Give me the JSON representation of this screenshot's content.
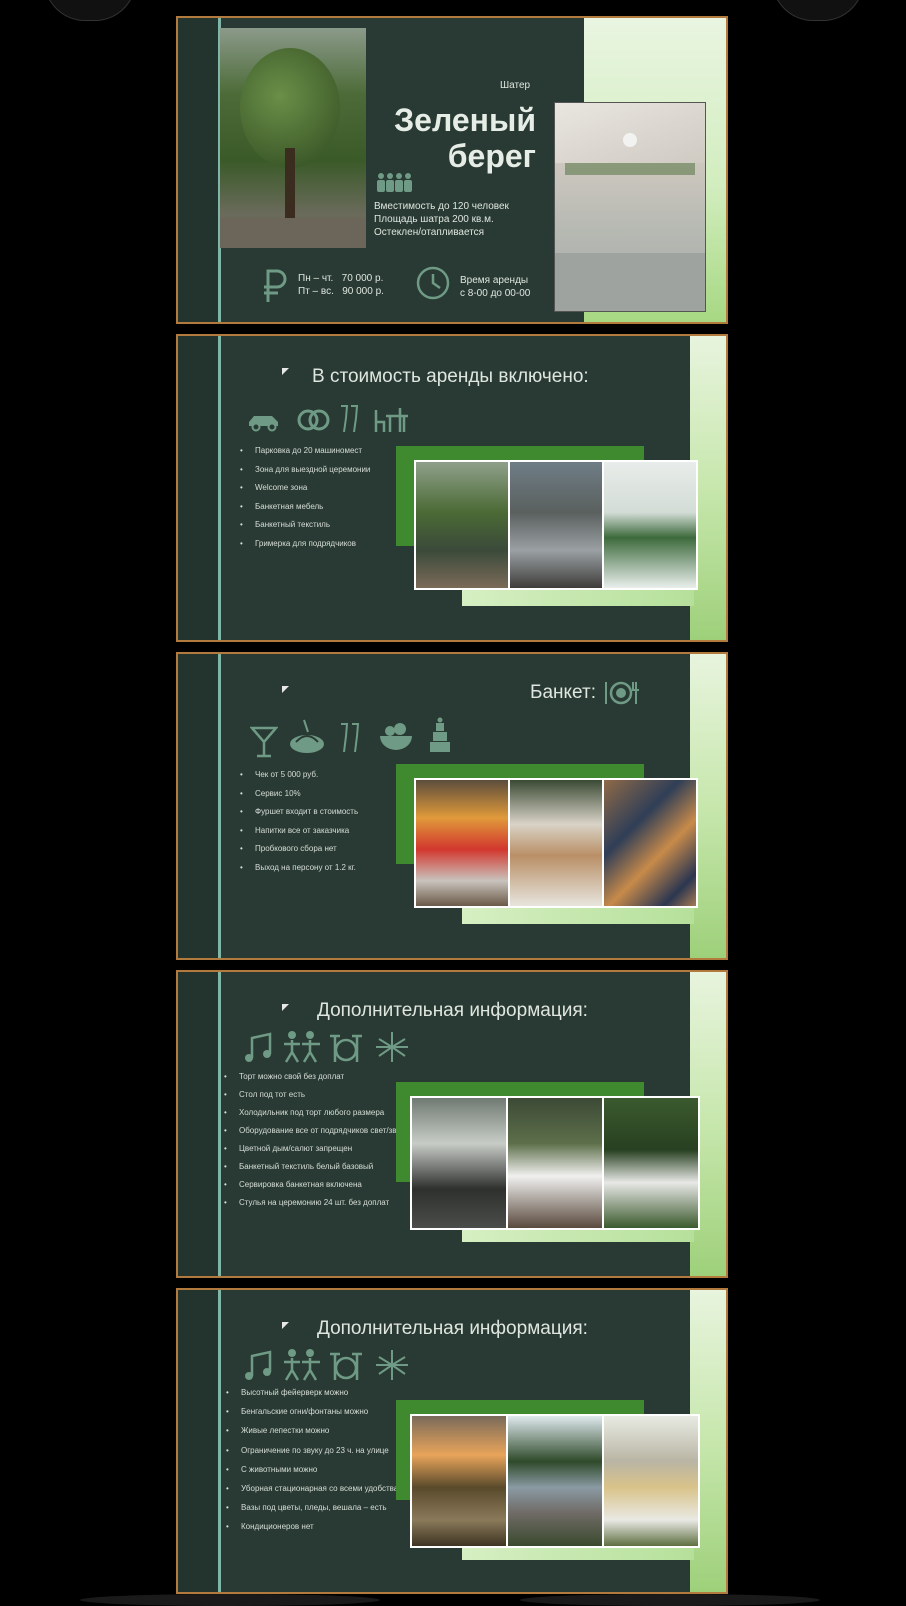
{
  "slide1": {
    "tag": "Шатер",
    "title_line1": "Зеленый",
    "title_line2": "берег",
    "features": [
      "Вместимость до 120 человек",
      "Площадь шатра 200 кв.м.",
      "Остеклен/отапливается"
    ],
    "price_rows": [
      {
        "days": "Пн – чт.",
        "price": "70 000 р."
      },
      {
        "days": "Пт – вс.",
        "price": "90 000 р."
      }
    ],
    "rent_time_line1": "Время аренды",
    "rent_time_line2": "с 8-00 до 00-00",
    "icons": [
      "tree-photo",
      "tent-interior-photo",
      "people-icon",
      "ruble-icon",
      "clock-icon"
    ]
  },
  "slide2": {
    "title": "В стоимость аренды включено:",
    "items": [
      "Парковка до 20 машиномест",
      "Зона для выездной церемонии",
      "Welcome зона",
      "Банкетная мебель",
      "Банкетный текстиль",
      "Гримерка для подрядчиков"
    ],
    "icons": [
      "car-icon",
      "rings-icon",
      "champagne-icon",
      "furniture-icon"
    ]
  },
  "slide3": {
    "title": "Банкет:",
    "items": [
      "Чек от 5 000 руб.",
      "Сервис 10%",
      "Фуршет входит в стоимость",
      "Напитки все от заказчика",
      "Пробкового сбора нет",
      "Выход на персону от 1.2 кг."
    ],
    "icons": [
      "plate-cutlery-icon",
      "cocktail-icon",
      "food-icon",
      "champagne-icon",
      "fruit-bowl-icon",
      "cake-icon"
    ]
  },
  "slide4": {
    "title": "Дополнительная информация:",
    "items": [
      "Торт можно свой без доплат",
      "Стол под тот есть",
      "Холодильник под торт любого размера",
      "Оборудование все от подрядчиков свет/звук",
      "Цветной дым/салют запрещен",
      "Банкетный текстиль белый базовый",
      "Сервировка банкетная включена",
      "Стулья на церемонию 24 шт. без доплат"
    ],
    "icons": [
      "music-notes-icon",
      "dancers-icon",
      "drums-icon",
      "fireworks-icon"
    ]
  },
  "slide5": {
    "title": "Дополнительная информация:",
    "items": [
      "Высотный фейерверк можно",
      "Бенгальские огни/фонтаны можно",
      "Живые лепестки можно",
      "Ограничение по звуку до 23 ч. на улице",
      "С животными можно",
      "Уборная стационарная со всеми удобствами",
      "Вазы под цветы, пледы, вешала – есть",
      "Кондиционеров нет"
    ],
    "icons": [
      "music-notes-icon",
      "dancers-icon",
      "drums-icon",
      "fireworks-icon"
    ]
  },
  "colors": {
    "slide_bg": "#283a33",
    "accent_green": "#3f8a2e",
    "border": "#b27a3c",
    "icon": "#6f9a85"
  }
}
